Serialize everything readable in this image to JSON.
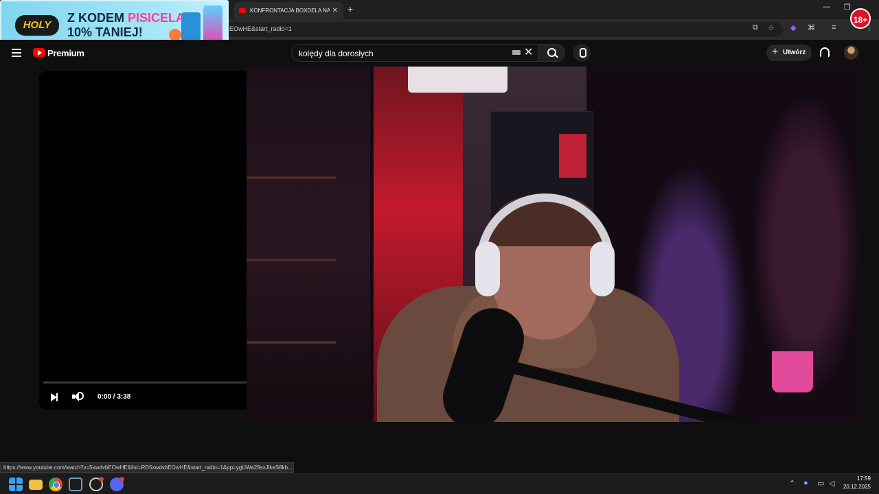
{
  "browser": {
    "tab_title": "KONFRONTACJA BOXDELA NA",
    "url_fragment": "EOwHE&start_radio=1",
    "status_url": "https://www.youtube.com/watch?v=5xwdvbEOwHE&list=RD5xwdvbEOwHE&start_radio=1&pp=ygUWa29sxJlkeS8kb..."
  },
  "ad": {
    "brand": "HOLY",
    "line1_prefix": "Z KODEM ",
    "line1_highlight": "PISICELA",
    "line2": "10% TANIEJ!"
  },
  "youtube": {
    "logo_text": "Premium",
    "search_value": "kolędy dla dorosłych",
    "create_label": "Utwórz"
  },
  "player": {
    "time": "0:00 / 3:38",
    "progress": 0
  },
  "overlay": {
    "age_badge": "18+"
  },
  "taskbar": {
    "time": "17:59",
    "date": "20.12.2025"
  },
  "colors": {
    "yt_red": "#ff0000",
    "age_badge": "#d4142c",
    "ad_bg": "#a7e6f8"
  }
}
